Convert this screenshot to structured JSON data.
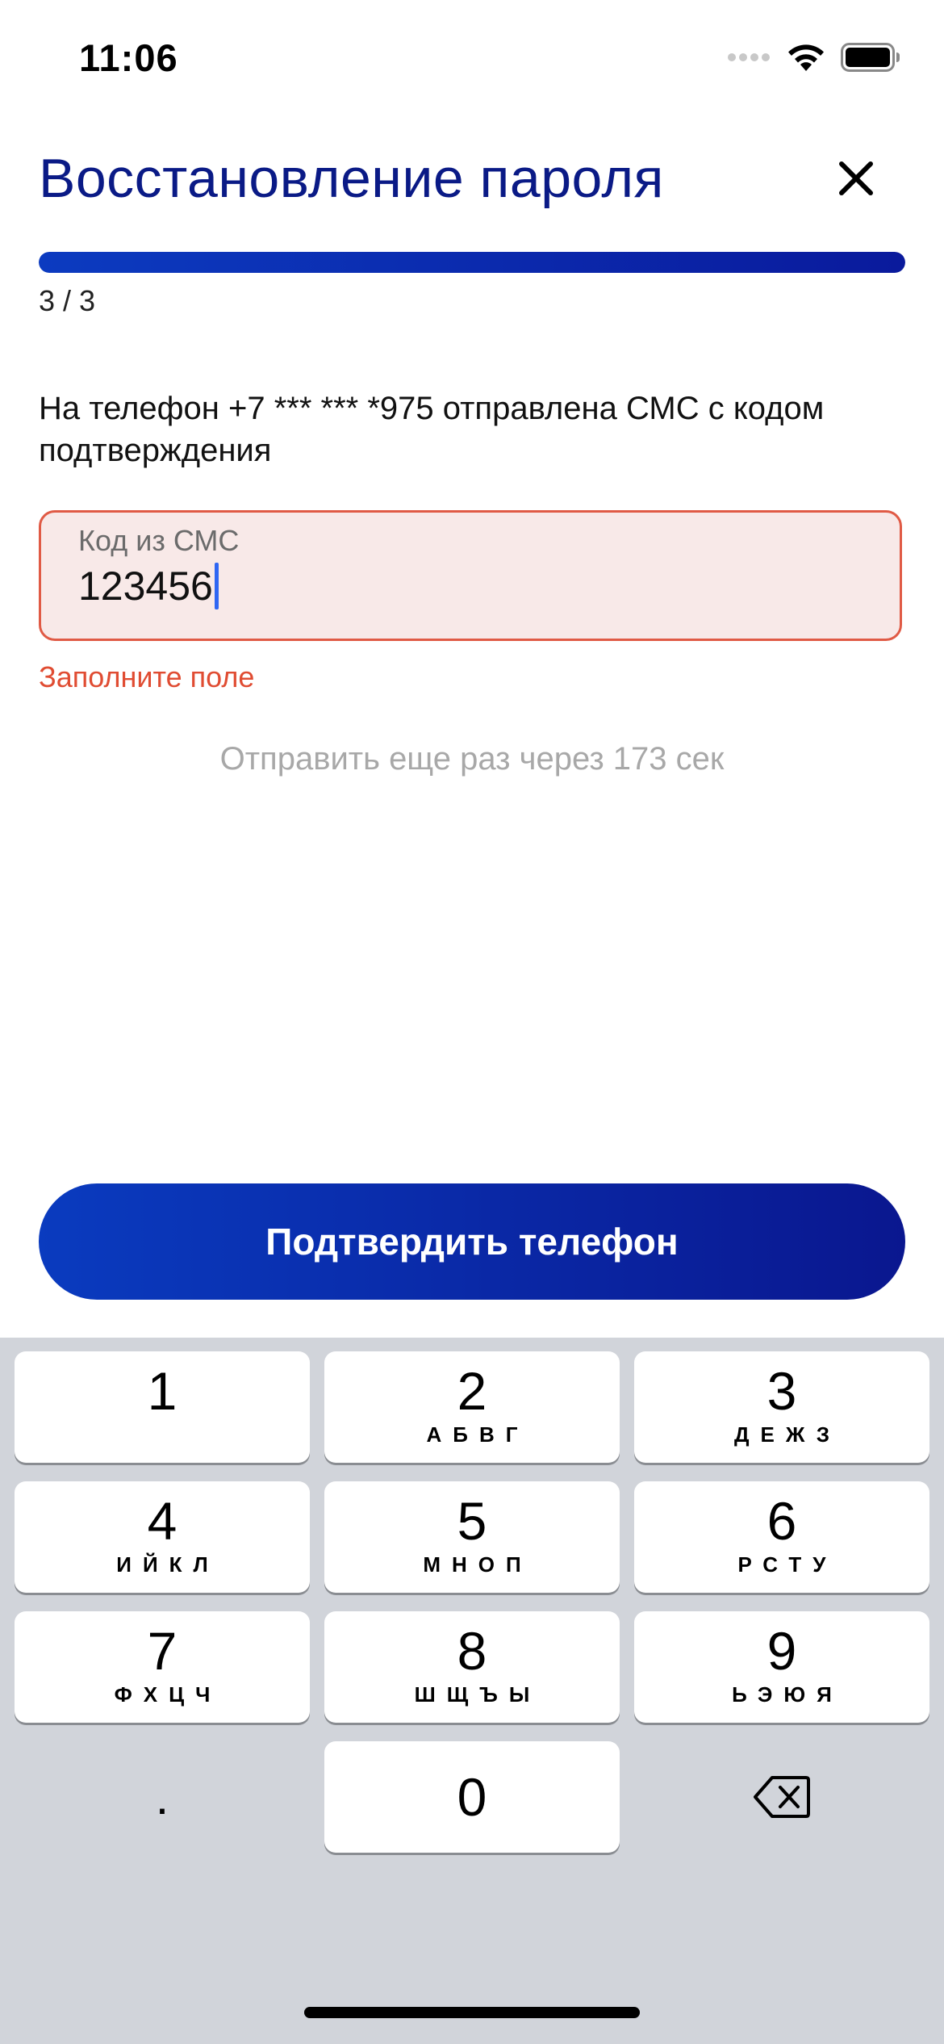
{
  "status_bar": {
    "time": "11:06"
  },
  "header": {
    "title": "Восстановление пароля",
    "close_icon": "close-icon"
  },
  "progress": {
    "fraction": 1.0,
    "step_label": "3 / 3"
  },
  "message": "На телефон +7 *** *** *975 отправлена СМС с кодом подтверждения",
  "code_field": {
    "label": "Код из СМС",
    "value": "123456",
    "error": "Заполните поле"
  },
  "resend_timer": "Отправить еще раз через 173 сек",
  "confirm_button": "Подтвердить телефон",
  "keyboard": {
    "keys": [
      {
        "num": "1",
        "letters": ""
      },
      {
        "num": "2",
        "letters": "АБВГ"
      },
      {
        "num": "3",
        "letters": "ДЕЖЗ"
      },
      {
        "num": "4",
        "letters": "ИЙКЛ"
      },
      {
        "num": "5",
        "letters": "МНОП"
      },
      {
        "num": "6",
        "letters": "РСТУ"
      },
      {
        "num": "7",
        "letters": "ФХЦЧ"
      },
      {
        "num": "8",
        "letters": "ШЩЪЫ"
      },
      {
        "num": "9",
        "letters": "ЬЭЮЯ"
      }
    ],
    "dot": ".",
    "zero": "0",
    "backspace_icon": "backspace-icon"
  },
  "colors": {
    "title": "#0a1a86",
    "accent": "#0a3bbf",
    "error": "#e04c32",
    "field_bg": "#f8e9e8"
  }
}
